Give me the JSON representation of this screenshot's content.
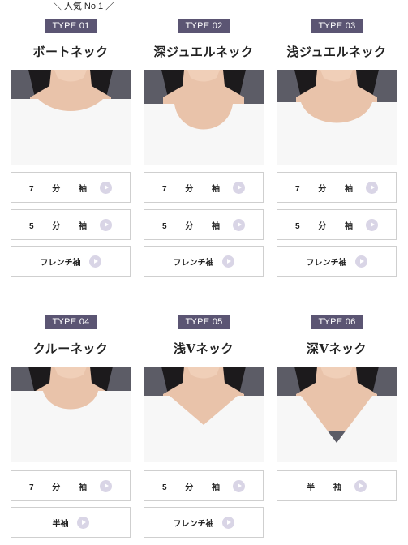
{
  "popular_label": "＼ 人気 No.1 ／",
  "colors": {
    "badge_bg": "#5b5573",
    "play_icon": "#d9d5e6",
    "button_border": "#cfcfcf"
  },
  "icons": {
    "play": "play-circle-icon"
  },
  "necklines": [
    {
      "type": "TYPE 01",
      "name": "ボートネック",
      "neck": "boat",
      "sleeves": [
        {
          "label": "7 分 袖",
          "spaced": true
        },
        {
          "label": "5 分 袖",
          "spaced": true
        },
        {
          "label": "フレンチ袖",
          "spaced": false
        }
      ]
    },
    {
      "type": "TYPE 02",
      "name": "深ジュエルネック",
      "neck": "deep-jewel",
      "sleeves": [
        {
          "label": "7 分 袖",
          "spaced": true
        },
        {
          "label": "5 分 袖",
          "spaced": true
        },
        {
          "label": "フレンチ袖",
          "spaced": false
        }
      ]
    },
    {
      "type": "TYPE 03",
      "name": "浅ジュエルネック",
      "neck": "shallow-jewel",
      "sleeves": [
        {
          "label": "7 分 袖",
          "spaced": true
        },
        {
          "label": "5 分 袖",
          "spaced": true
        },
        {
          "label": "フレンチ袖",
          "spaced": false
        }
      ]
    },
    {
      "type": "TYPE 04",
      "name": "クルーネック",
      "neck": "crew",
      "sleeves": [
        {
          "label": "7 分 袖",
          "spaced": true
        },
        {
          "label": "半袖",
          "spaced": false
        }
      ]
    },
    {
      "type": "TYPE 05",
      "name": "浅Vネック",
      "neck": "shallow-v",
      "sleeves": [
        {
          "label": "5 分 袖",
          "spaced": true
        },
        {
          "label": "フレンチ袖",
          "spaced": false
        }
      ]
    },
    {
      "type": "TYPE 06",
      "name": "深Vネック",
      "neck": "deep-v",
      "sleeves": [
        {
          "label": "半 袖",
          "spaced": true
        }
      ]
    }
  ]
}
